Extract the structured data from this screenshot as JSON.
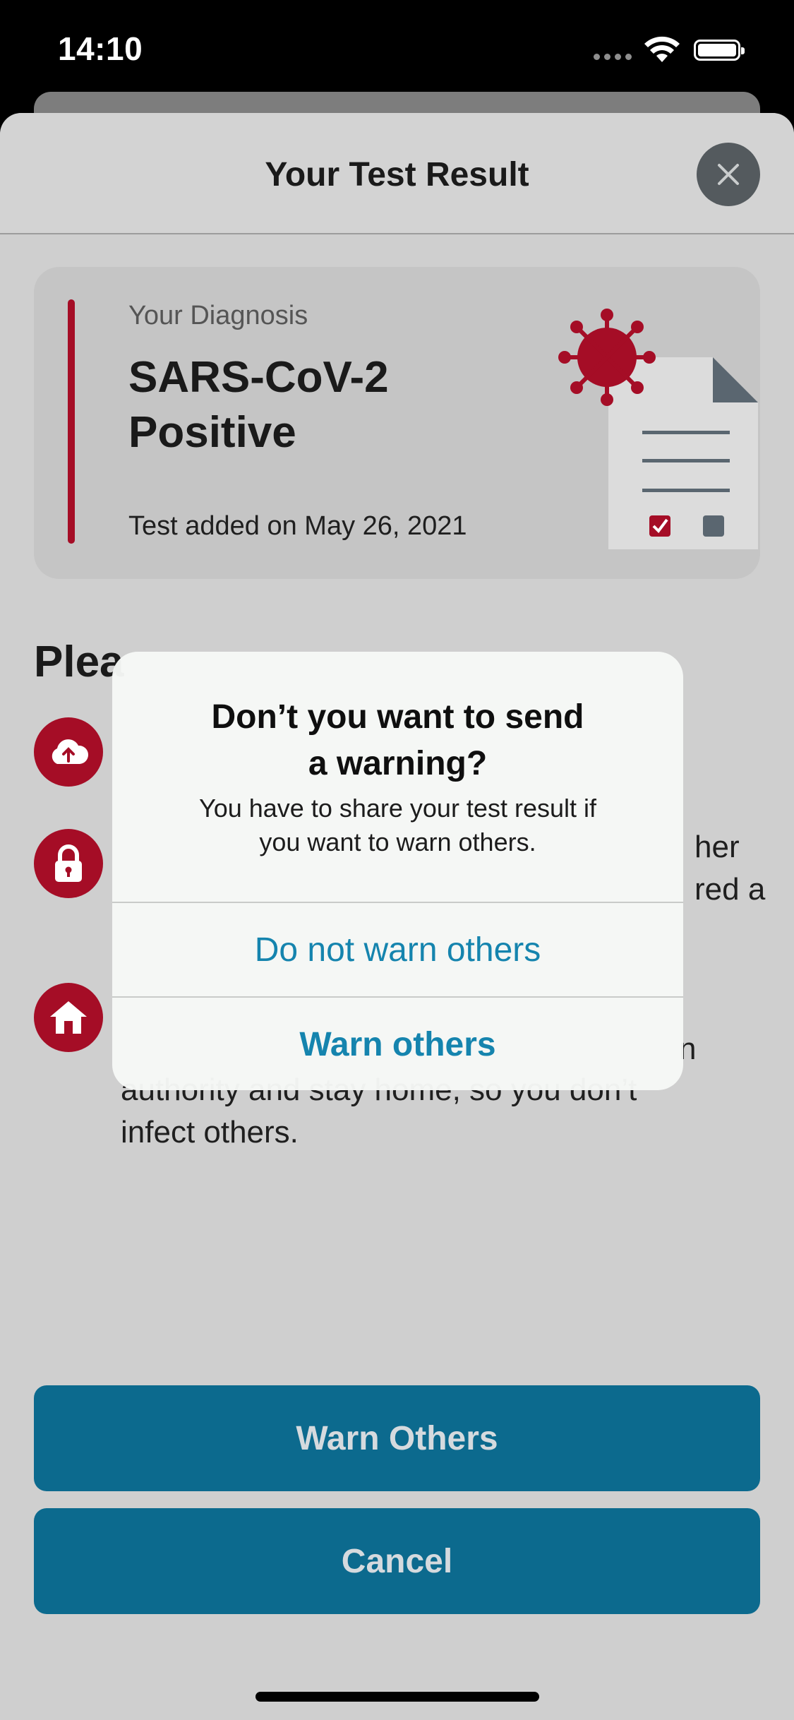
{
  "status_bar": {
    "time": "14:10"
  },
  "sheet": {
    "title": "Your Test Result",
    "close_icon": "close-icon"
  },
  "diagnosis": {
    "label": "Your Diagnosis",
    "value_line1": "SARS-CoV-2",
    "value_line2": "Positive",
    "date_text": "Test added on May 26, 2021",
    "accent_color": "#a50d26",
    "illustration": "virus-document-checklist"
  },
  "info": {
    "heading": "Plea",
    "items": [
      {
        "icon": "cloud-upload-icon",
        "text": []
      },
      {
        "icon": "lock-icon",
        "text": [
          "her",
          "red a"
        ]
      },
      {
        "icon": "home-icon",
        "text": [
          "n",
          "authority and stay home, so you don’t",
          "infect others."
        ]
      }
    ]
  },
  "buttons": {
    "warn_others": "Warn Others",
    "cancel": "Cancel",
    "color": "#0c6a8e"
  },
  "alert": {
    "title_line1": "Don’t you want to send",
    "title_line2": "a warning?",
    "message_line1": "You have to share your test result if",
    "message_line2": "you want to warn others.",
    "action_secondary": "Do not warn others",
    "action_primary": "Warn others",
    "action_color": "#1584ae"
  }
}
